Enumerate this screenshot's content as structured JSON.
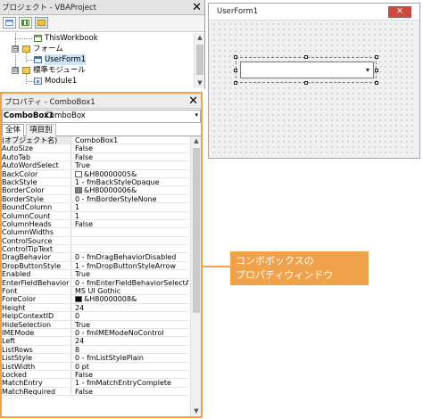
{
  "project_pane": {
    "title": "プロジェクト - VBAProject",
    "close_glyph": "✕",
    "tree": [
      {
        "label": "ThisWorkbook"
      },
      {
        "label": "フォーム",
        "expander": "⊟"
      },
      {
        "label": "UserForm1"
      },
      {
        "label": "標準モジュール",
        "expander": "⊟"
      },
      {
        "label": "Module1"
      }
    ]
  },
  "form_window": {
    "title": "UserForm1",
    "close_glyph": "✕",
    "combo_arrow": "▾"
  },
  "properties": {
    "title": "プロパティ - ComboBox1",
    "close_glyph": "✕",
    "object_name": "ComboBox1",
    "object_type": "ComboBox",
    "dropdown_arrow": "▾",
    "tabs": [
      "全体",
      "項目別"
    ],
    "rows": [
      {
        "name": "(オブジェクト名)",
        "value": "ComboBox1"
      },
      {
        "name": "AutoSize",
        "value": "False"
      },
      {
        "name": "AutoTab",
        "value": "False"
      },
      {
        "name": "AutoWordSelect",
        "value": "True"
      },
      {
        "name": "BackColor",
        "value": "&H80000005&",
        "swatch": "#ffffff"
      },
      {
        "name": "BackStyle",
        "value": "1 - fmBackStyleOpaque"
      },
      {
        "name": "BorderColor",
        "value": "&H80000006&",
        "swatch": "#808080"
      },
      {
        "name": "BorderStyle",
        "value": "0 - fmBorderStyleNone"
      },
      {
        "name": "BoundColumn",
        "value": "1"
      },
      {
        "name": "ColumnCount",
        "value": "1"
      },
      {
        "name": "ColumnHeads",
        "value": "False"
      },
      {
        "name": "ColumnWidths",
        "value": ""
      },
      {
        "name": "ControlSource",
        "value": ""
      },
      {
        "name": "ControlTipText",
        "value": ""
      },
      {
        "name": "DragBehavior",
        "value": "0 - fmDragBehaviorDisabled"
      },
      {
        "name": "DropButtonStyle",
        "value": "1 - fmDropButtonStyleArrow"
      },
      {
        "name": "Enabled",
        "value": "True"
      },
      {
        "name": "EnterFieldBehavior",
        "value": "0 - fmEnterFieldBehaviorSelectAll"
      },
      {
        "name": "Font",
        "value": "MS UI Gothic"
      },
      {
        "name": "ForeColor",
        "value": "&H80000008&",
        "swatch": "#000000"
      },
      {
        "name": "Height",
        "value": "24"
      },
      {
        "name": "HelpContextID",
        "value": "0"
      },
      {
        "name": "HideSelection",
        "value": "True"
      },
      {
        "name": "IMEMode",
        "value": "0 - fmIMEModeNoControl"
      },
      {
        "name": "Left",
        "value": "24"
      },
      {
        "name": "ListRows",
        "value": "8"
      },
      {
        "name": "ListStyle",
        "value": "0 - fmListStylePlain"
      },
      {
        "name": "ListWidth",
        "value": "0 pt"
      },
      {
        "name": "Locked",
        "value": "False"
      },
      {
        "name": "MatchEntry",
        "value": "1 - fmMatchEntryComplete"
      },
      {
        "name": "MatchRequired",
        "value": "False"
      }
    ]
  },
  "annotation": {
    "line1": "コンボボックスの",
    "line2": "プロパティウィンドウ"
  },
  "colors": {
    "accent": "#f0a24a",
    "close_button": "#c94b3f",
    "selection": "#cce4f7"
  }
}
